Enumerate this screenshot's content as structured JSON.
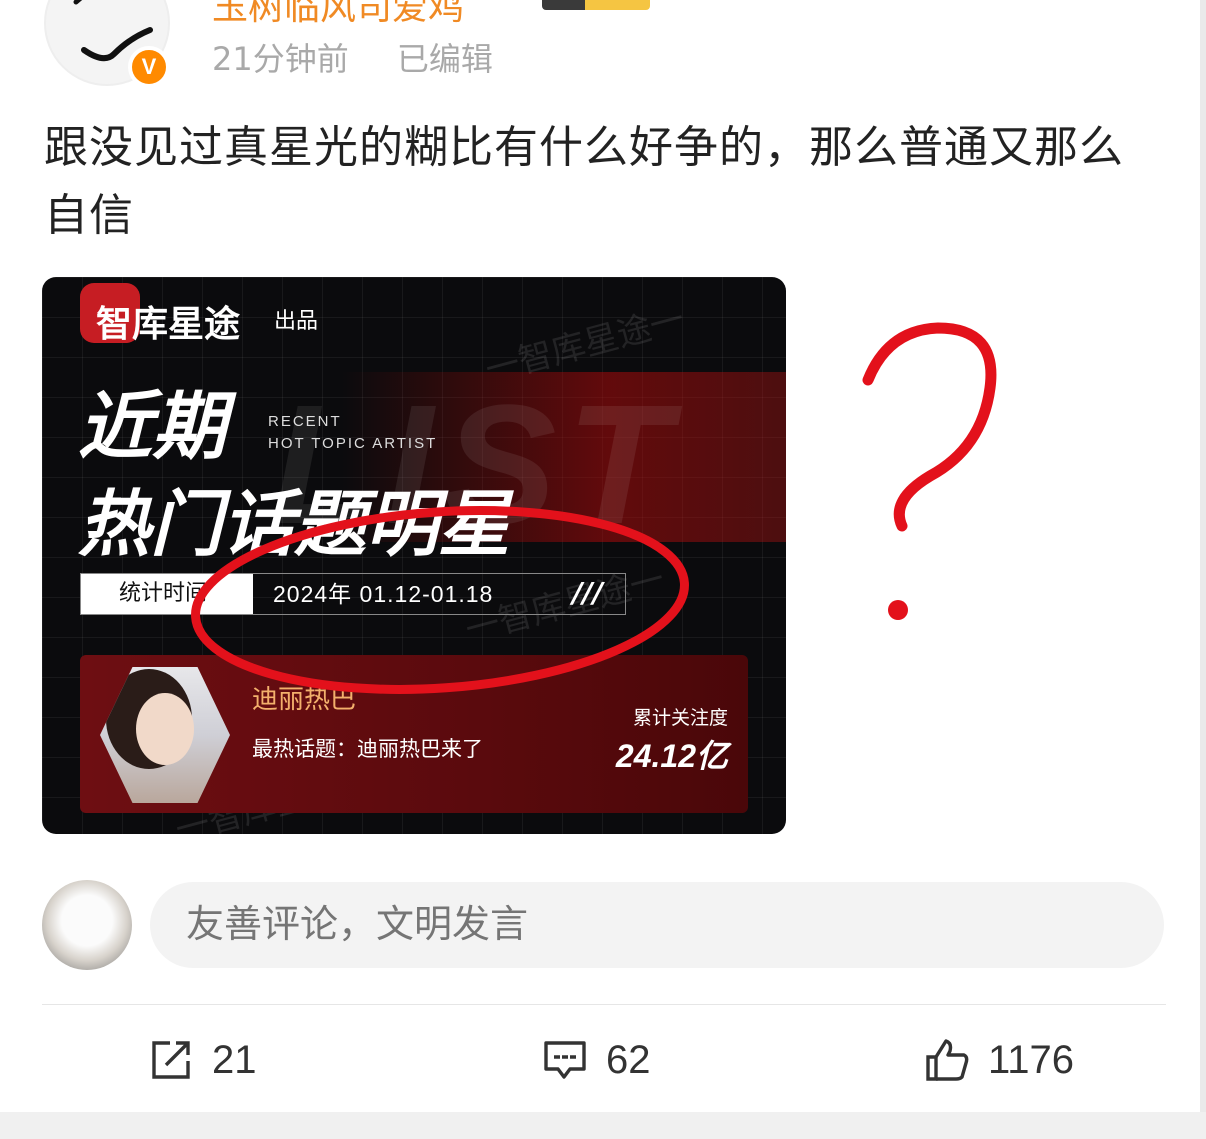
{
  "post": {
    "username": "玉树临风司爱鸡",
    "time": "21分钟前",
    "edited": "已编辑",
    "verified_mark": "V",
    "text": "跟没见过真星光的糊比有什么好争的，那么普通又那么自信"
  },
  "image": {
    "brand": "智库星途",
    "brand_suffix": "出品",
    "title_line1": "近期",
    "title_line2": "热门话题明星",
    "eng_line1": "RECENT",
    "eng_line2": "HOT TOPIC ARTIST",
    "bg_word": "LIST",
    "stat_label": "统计时间",
    "stat_value": "2024年  01.12-01.18",
    "stat_slashes": "///",
    "star_name": "迪丽热巴",
    "star_topic": "最热话题：迪丽热巴来了",
    "metric_label": "累计关注度",
    "metric_value": "24.12亿",
    "watermark": "一智库星途一"
  },
  "comment": {
    "placeholder": "友善评论，文明发言"
  },
  "actions": {
    "share_count": "21",
    "comment_count": "62",
    "like_count": "1176"
  },
  "annotation": {
    "question_mark": "?",
    "color": "#e3111b"
  }
}
